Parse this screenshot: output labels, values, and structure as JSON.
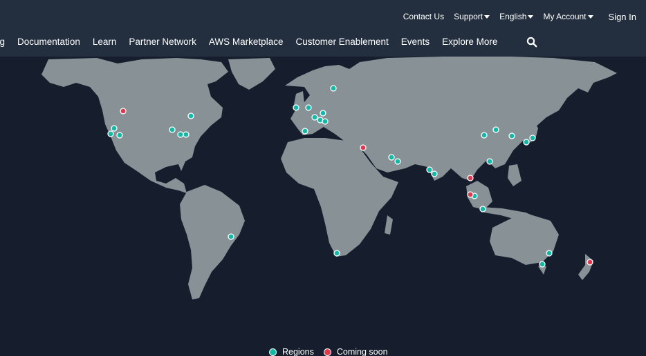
{
  "colors": {
    "topbar_bg": "#232f3e",
    "map_bg": "#161e2d",
    "land": "#879196",
    "region_dot": "#14b8a6",
    "coming_soon_dot": "#e0384f",
    "text": "#ffffff"
  },
  "utility_nav": {
    "contact_us": "Contact Us",
    "support": "Support",
    "english": "English",
    "my_account": "My Account",
    "sign_in": "Sign In"
  },
  "main_nav": {
    "items": [
      "ng",
      "Documentation",
      "Learn",
      "Partner Network",
      "AWS Marketplace",
      "Customer Enablement",
      "Events",
      "Explore More"
    ],
    "search_icon": "search-icon"
  },
  "legend": {
    "regions_label": "Regions",
    "coming_soon_label": "Coming soon"
  }
}
